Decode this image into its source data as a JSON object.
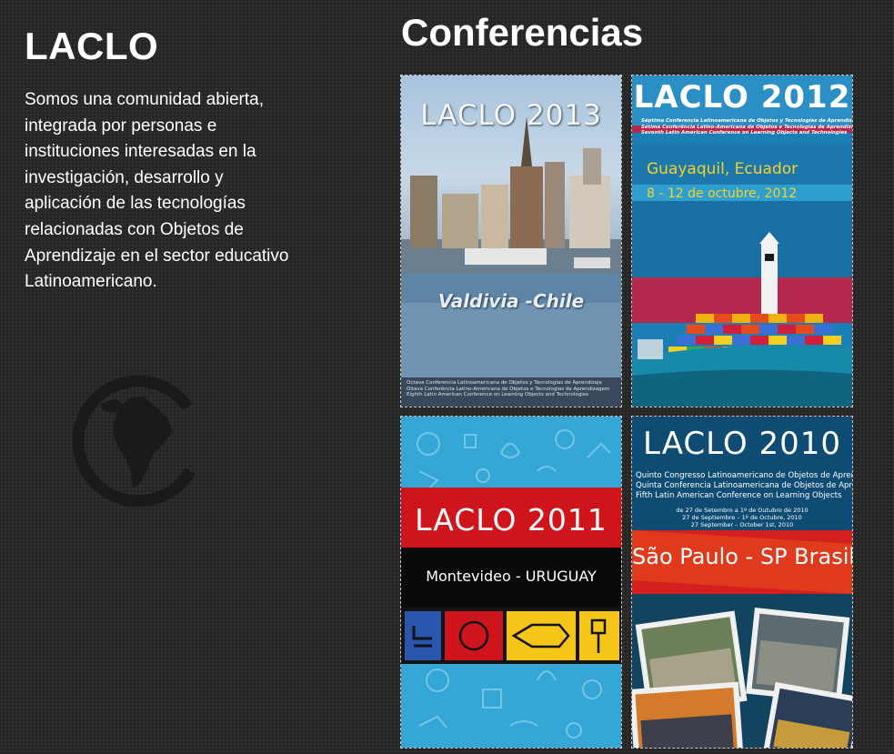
{
  "site": {
    "title": "LACLO",
    "description": "Somos una comunidad abierta, integrada por personas e instituciones interesadas en la investigación, desarrollo y aplicación de las tecnologías relacionadas con Objetos de Aprendizaje en el sector educativo Latinoamericano.",
    "logo_icon": "laclo-globe-logo"
  },
  "conferences": {
    "heading": "Conferencias",
    "c2013": {
      "title": "LACLO 2013",
      "location": "Valdivia -Chile",
      "footer": [
        "Octava Conferencia Latinoamericana de Objetos y Tecnologías de Aprendizaje",
        "Oitava Conferência Latino-Americana de Objetos e Tecnologias de Aprendizagem",
        "Eighth Latin American Conference on Learning Objects and Technologies"
      ]
    },
    "c2012": {
      "title": "LACLO 2012",
      "subtitle": [
        "Séptima Conferencia Latinoamericana de Objetos y Tecnologías de Aprendizaje",
        "Sétima Conferência Latino-Americana de Objetos e Tecnologias de Aprendizagem",
        "Seventh Latin American Conference on Learning Objects and Technologies"
      ],
      "location": "Guayaquil, Ecuador",
      "dates": "8 - 12  de octubre, 2012"
    },
    "c2011": {
      "title": "LACLO 2011",
      "location": "Montevideo - URUGUAY"
    },
    "c2010": {
      "title": "LACLO 2010",
      "subtitle": [
        "Quinto Congresso Latinoamericano de Objetos de Aprendizagem",
        "Quinta Conferencia Latinoamericana de Objetos de Aprendizaje",
        "Fifth Latin American Conference on Learning Objects"
      ],
      "dates": [
        "de 27 de Setembro a 1º de Outubro de 2010",
        "27 de Septiembre – 1º de Octubre, 2010",
        "27 September – October 1st, 2010"
      ],
      "location": "São Paulo - SP Brasil"
    }
  },
  "colors": {
    "background": "#262626",
    "uruguay_red": "#d0141b",
    "ecuador_band": "#b3284c"
  }
}
